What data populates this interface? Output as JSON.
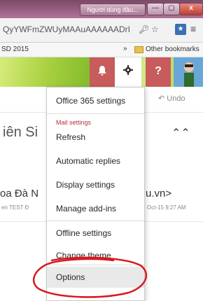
{
  "window": {
    "user_label": "Người dùng đầu...",
    "minimize": "—",
    "maximize": "▢",
    "close": "x"
  },
  "addressbar": {
    "url": "QyYWFmZWUyMAAuAAAAAADrI",
    "star_icon": "star-icon",
    "key_icon": "key-icon",
    "extension_icon": "extension-icon",
    "menu_icon": "hamburger-menu-icon"
  },
  "bookmarks": {
    "left_item": "SD 2015",
    "chevron": "»",
    "other": "Other bookmarks"
  },
  "header": {
    "bell_icon": "bell-icon",
    "gear_icon": "gear-icon",
    "help_label": "?",
    "avatar_icon": "avatar-icon",
    "colors": {
      "bell_bg": "#c85b5b",
      "gear_bg": "#ffffff",
      "header_green": "#9dcb3c"
    }
  },
  "background": {
    "undo_label": "Undo",
    "title": "iên Si",
    "sender": "oa Đà N",
    "email": "u.vn>",
    "sub": "en TEST",
    "sub2": "Đ",
    "date": "Oct-15 9:27 AM"
  },
  "settings_menu": {
    "office365": "Office 365 settings",
    "section_label": "Mail settings",
    "items": [
      "Refresh",
      "Automatic replies",
      "Display settings",
      "Manage add-ins"
    ],
    "offline": "Offline settings",
    "change_theme": "Change theme",
    "options": "Options"
  },
  "annotation": {
    "color": "#d71920"
  }
}
